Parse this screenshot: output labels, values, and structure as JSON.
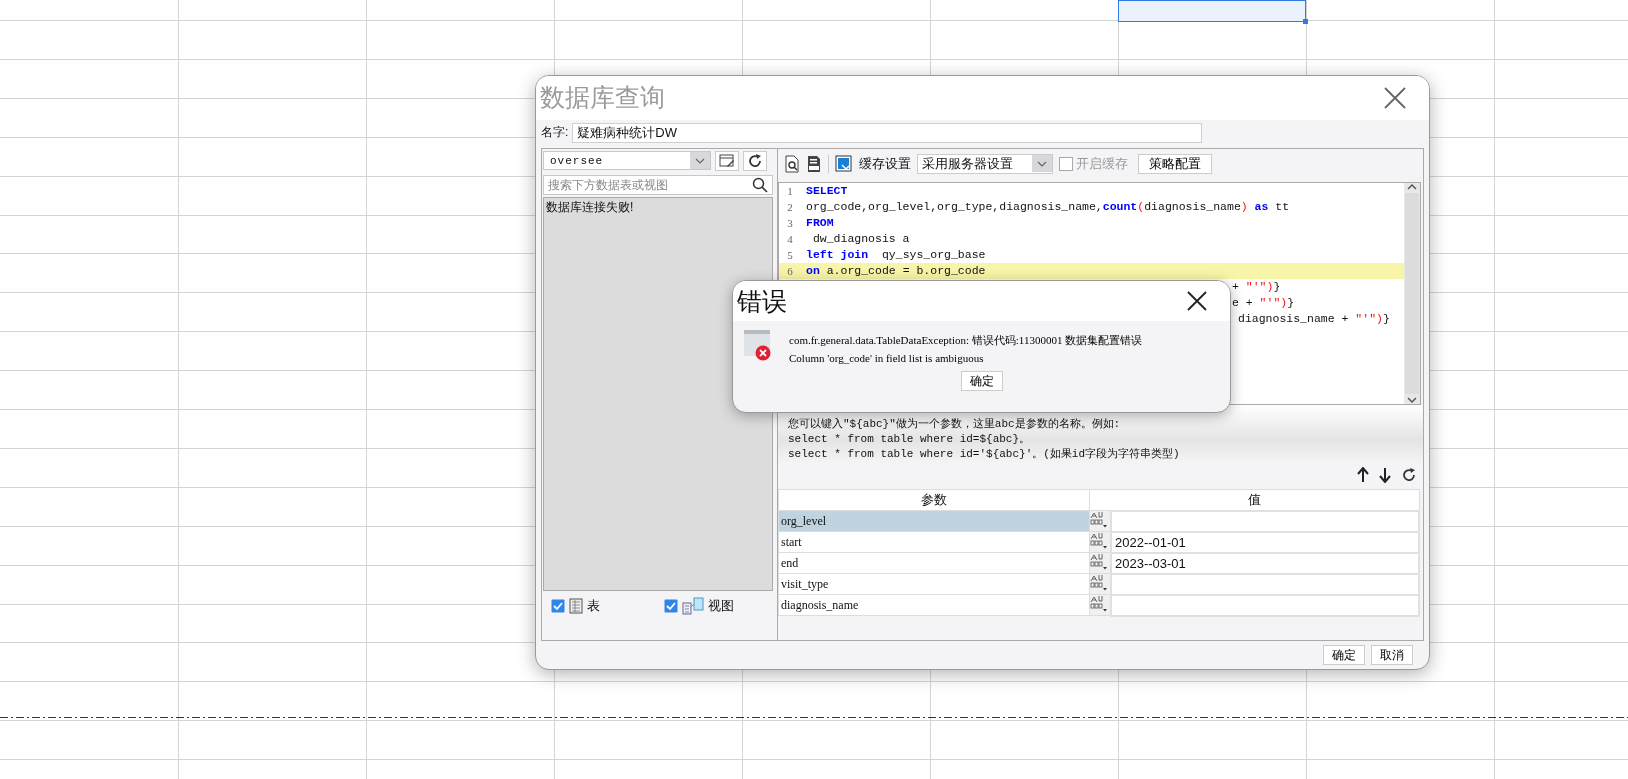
{
  "sheet": {
    "cell_selected": true
  },
  "dialog": {
    "title": "数据库查询",
    "name_label": "名字:",
    "name_value": "疑难病种统计DW",
    "connection": {
      "value": "oversee"
    },
    "search": {
      "placeholder": "搜索下方数据表或视图"
    },
    "status_message": "数据库连接失败!",
    "filters": [
      {
        "kind": "table",
        "label": "表",
        "checked": true
      },
      {
        "kind": "view",
        "label": "视图",
        "checked": true
      }
    ],
    "toolbar": {
      "cache_label": "缓存设置",
      "cache_mode": "采用服务器设置",
      "enable_cache": {
        "label": "开启缓存",
        "checked": false,
        "disabled": true
      },
      "policy_button": "策略配置"
    },
    "code_lines": [
      {
        "number": "1",
        "highlighted": false,
        "tokens": [
          {
            "kind": "keyword",
            "text": "SELECT"
          }
        ]
      },
      {
        "number": "2",
        "highlighted": false,
        "tokens": [
          {
            "kind": "plain",
            "text": "org_code,org_level,org_type,diagnosis_name,"
          },
          {
            "kind": "keyword",
            "text": "count"
          },
          {
            "kind": "paren",
            "text": "("
          },
          {
            "kind": "plain",
            "text": "diagnosis_name"
          },
          {
            "kind": "paren",
            "text": ")"
          },
          {
            "kind": "keyword",
            "text": " as"
          },
          {
            "kind": "plain",
            "text": " tt"
          }
        ]
      },
      {
        "number": "3",
        "highlighted": false,
        "tokens": [
          {
            "kind": "keyword",
            "text": "FROM"
          }
        ]
      },
      {
        "number": "4",
        "highlighted": false,
        "tokens": [
          {
            "kind": "plain",
            "text": " dw_diagnosis a"
          }
        ]
      },
      {
        "number": "5",
        "highlighted": false,
        "tokens": [
          {
            "kind": "keyword",
            "text": "left join"
          },
          {
            "kind": "plain",
            "text": "  qy_sys_org_base"
          }
        ]
      },
      {
        "number": "6",
        "highlighted": true,
        "tokens": [
          {
            "kind": "keyword",
            "text": "on"
          },
          {
            "kind": "plain",
            "text": " a.org_code = b.org_code"
          }
        ]
      },
      {
        "highlighted": false,
        "tokens": [
          {
            "kind": "plain",
            "text": "+ "
          },
          {
            "kind": "string",
            "text": "\"'\""
          },
          {
            "kind": "paren",
            "text": ")"
          },
          {
            "kind": "plain",
            "text": "}"
          }
        ]
      },
      {
        "highlighted": false,
        "tokens": [
          {
            "kind": "plain",
            "text": "e + "
          },
          {
            "kind": "string",
            "text": "\"'\""
          },
          {
            "kind": "paren",
            "text": ")"
          },
          {
            "kind": "plain",
            "text": "}"
          }
        ]
      },
      {
        "highlighted": false,
        "tokens": [
          {
            "kind": "plain",
            "text": "diagnosis_name + "
          },
          {
            "kind": "string",
            "text": "\"'\""
          },
          {
            "kind": "paren",
            "text": ")"
          },
          {
            "kind": "plain",
            "text": "}"
          }
        ]
      }
    ],
    "hint_lines": [
      "您可以键入\"${abc}\"做为一个参数，这里abc是参数的名称。例如:",
      "select * from table where id=${abc}。",
      "select * from table where id='${abc}'。(如果id字段为字符串类型)"
    ],
    "params": {
      "columns": [
        "参数",
        "值"
      ],
      "rows": [
        {
          "name": "org_level",
          "selected": true
        },
        {
          "name": "start",
          "value": "2022--01-01",
          "selected": false
        },
        {
          "name": "end",
          "value": "2023--03-01",
          "selected": false
        },
        {
          "name": "visit_type",
          "selected": false
        },
        {
          "name": "diagnosis_name",
          "selected": false
        }
      ]
    },
    "buttons": [
      "确定",
      "取消"
    ]
  },
  "error_dialog": {
    "title": "错误",
    "lines": [
      "com.fr.general.data.TableDataException: 错误代码:11300001 数据集配置错误",
      "Column 'org_code' in field list is ambiguous"
    ],
    "button": "确定"
  }
}
